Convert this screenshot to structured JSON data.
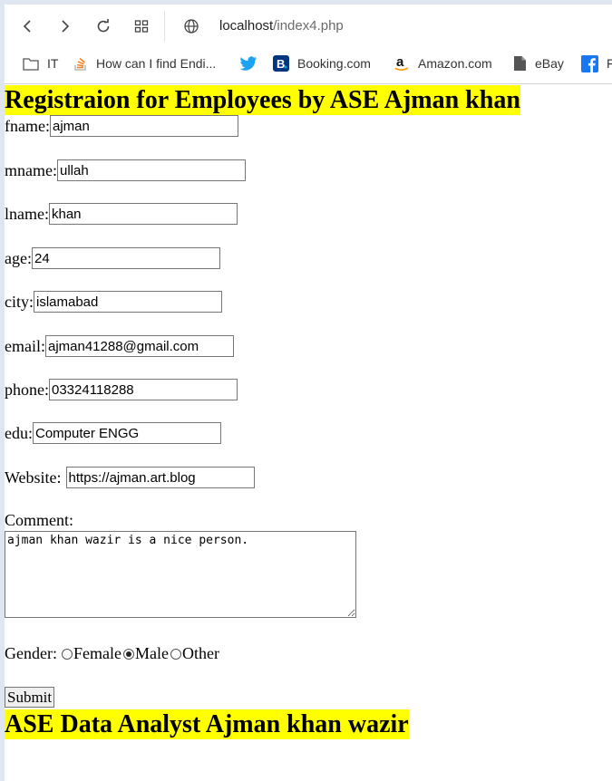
{
  "browser": {
    "url_host": "localhost",
    "url_path": "/index4.php",
    "bookmarks": [
      {
        "label": "IT",
        "icon": "folder-icon"
      },
      {
        "label": "How can I find Endi...",
        "icon": "stackoverflow-icon"
      },
      {
        "label": "",
        "icon": "twitter-icon"
      },
      {
        "label": "Booking.com",
        "icon": "booking-icon"
      },
      {
        "label": "Amazon.com",
        "icon": "amazon-icon"
      },
      {
        "label": "eBay",
        "icon": "document-icon"
      },
      {
        "label": "F",
        "icon": "facebook-icon"
      }
    ]
  },
  "page": {
    "heading": "Registraion for Employees by ASE Ajman khan",
    "footer_heading": "ASE Data Analyst Ajman khan wazir"
  },
  "form": {
    "fname": {
      "label": "fname:",
      "value": "ajman"
    },
    "mname": {
      "label": "mname:",
      "value": "ullah"
    },
    "lname": {
      "label": "lname:",
      "value": "khan"
    },
    "age": {
      "label": "age:",
      "value": "24"
    },
    "city": {
      "label": "city:",
      "value": "islamabad"
    },
    "email": {
      "label": "email:",
      "value": "ajman41288@gmail.com"
    },
    "phone": {
      "label": "phone:",
      "value": "03324118288"
    },
    "edu": {
      "label": "edu:",
      "value": "Computer ENGG"
    },
    "website": {
      "label": "Website:",
      "value": "https://ajman.art.blog"
    },
    "comment": {
      "label": "Comment:",
      "value": "ajman khan wazir is a nice person."
    },
    "gender": {
      "label": "Gender:",
      "options": [
        "Female",
        "Male",
        "Other"
      ],
      "selected": "Male"
    },
    "submit_label": "Submit"
  },
  "colors": {
    "highlight": "#ffff00",
    "twitter": "#1da1f2",
    "booking": "#003580",
    "facebook": "#1877f2",
    "stackoverflow": "#f48024"
  }
}
